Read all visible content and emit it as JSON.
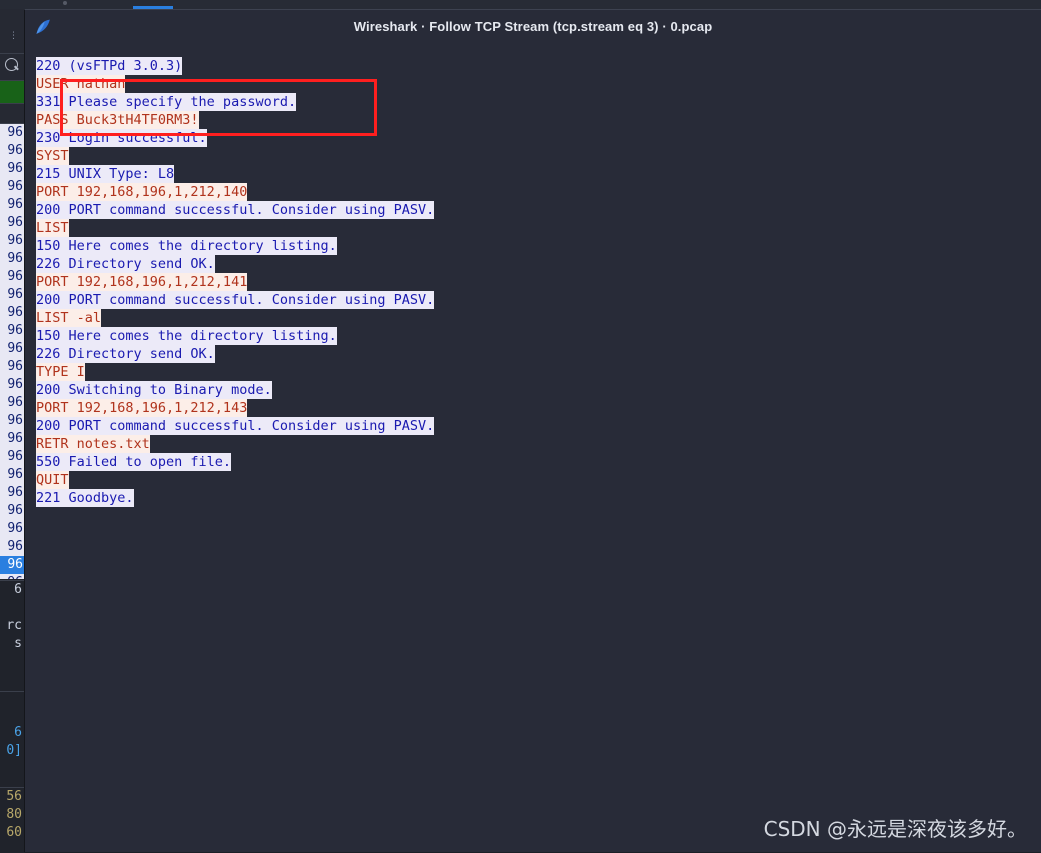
{
  "window": {
    "title": "Wireshark · Follow TCP Stream (tcp.stream eq 3) · 0.pcap",
    "logo_icon": "wireshark-fin-icon",
    "background_color": "#282b38"
  },
  "stream": {
    "server_text_color": "#1a1ab0",
    "server_bg_color": "#eceaf8",
    "client_text_color": "#b0331c",
    "client_bg_color": "#fceee8",
    "lines": [
      {
        "dir": "server",
        "text": "220 (vsFTPd 3.0.3)"
      },
      {
        "dir": "client",
        "text": "USER nathan"
      },
      {
        "dir": "server",
        "text": "331 Please specify the password."
      },
      {
        "dir": "client",
        "text": "PASS Buck3tH4TF0RM3!"
      },
      {
        "dir": "server",
        "text": "230 Login successful."
      },
      {
        "dir": "client",
        "text": "SYST"
      },
      {
        "dir": "server",
        "text": "215 UNIX Type: L8"
      },
      {
        "dir": "client",
        "text": "PORT 192,168,196,1,212,140"
      },
      {
        "dir": "server",
        "text": "200 PORT command successful. Consider using PASV."
      },
      {
        "dir": "client",
        "text": "LIST"
      },
      {
        "dir": "server",
        "text": "150 Here comes the directory listing."
      },
      {
        "dir": "server",
        "text": "226 Directory send OK."
      },
      {
        "dir": "client",
        "text": "PORT 192,168,196,1,212,141"
      },
      {
        "dir": "server",
        "text": "200 PORT command successful. Consider using PASV."
      },
      {
        "dir": "client",
        "text": "LIST -al"
      },
      {
        "dir": "server",
        "text": "150 Here comes the directory listing."
      },
      {
        "dir": "server",
        "text": "226 Directory send OK."
      },
      {
        "dir": "client",
        "text": "TYPE I"
      },
      {
        "dir": "server",
        "text": "200 Switching to Binary mode."
      },
      {
        "dir": "client",
        "text": "PORT 192,168,196,1,212,143"
      },
      {
        "dir": "server",
        "text": "200 PORT command successful. Consider using PASV."
      },
      {
        "dir": "client",
        "text": "RETR notes.txt"
      },
      {
        "dir": "server",
        "text": "550 Failed to open file."
      },
      {
        "dir": "client",
        "text": "QUIT"
      },
      {
        "dir": "server",
        "text": "221 Goodbye."
      }
    ]
  },
  "annotation": {
    "color": "#ff1f1f",
    "covers_lines": [
      "USER nathan",
      "331 Please specify the password.",
      "PASS Buck3tH4TF0RM3!"
    ]
  },
  "background_window": {
    "toolbar_glyph": "⋮",
    "search_icon": "search-icon",
    "filter_bar_color": "#186218",
    "packet_list_fragments": [
      "96",
      "96",
      "96",
      "96",
      "96",
      "96",
      "96",
      "96",
      "96",
      "96",
      "96",
      "96",
      "96",
      "96",
      "96",
      "96",
      "96",
      "96",
      "96",
      "96",
      "96",
      "96",
      "96",
      "96",
      "96"
    ],
    "selected_row_index": 24,
    "selected_row_text": "96",
    "mid_pane_fragments": [
      "6",
      "",
      "rc",
      "s"
    ],
    "detail_pane_fragments": [
      "",
      "6",
      "0]"
    ],
    "bytes_pane_fragments": [
      "56",
      "80",
      "60"
    ]
  },
  "watermark": {
    "text": "CSDN @永远是深夜该多好。"
  }
}
